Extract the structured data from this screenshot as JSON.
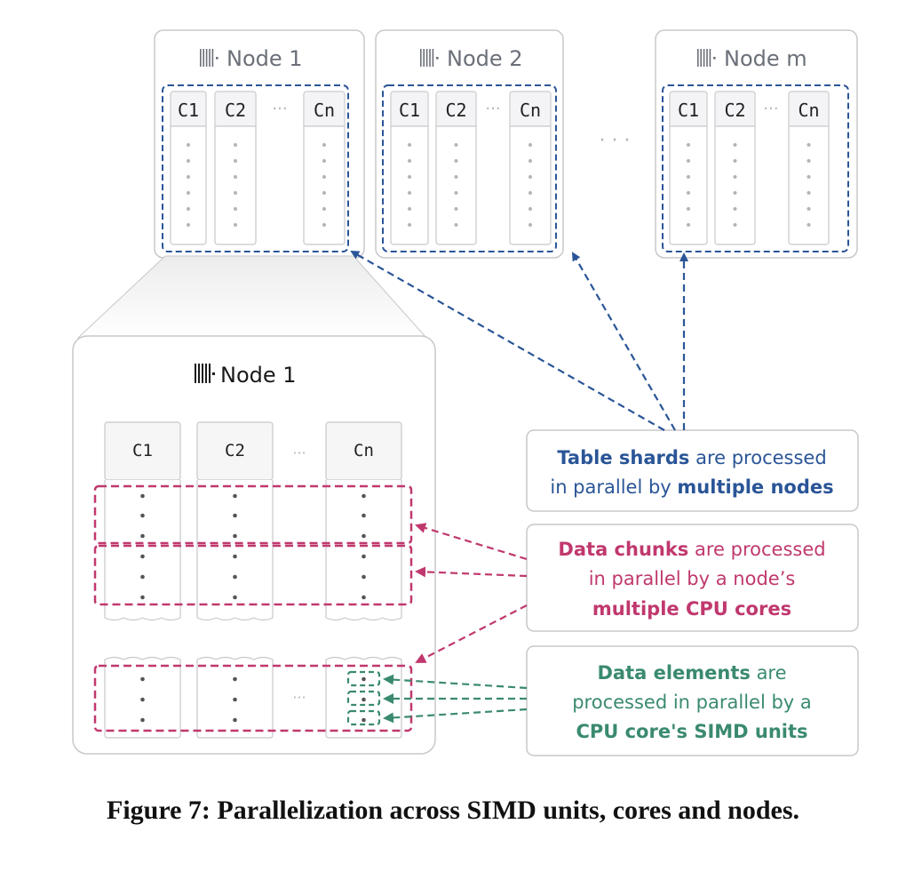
{
  "colors": {
    "blue": "#2a5597",
    "pink": "#c0386e",
    "green": "#3a8a6e",
    "box_border": "#c8c8cc",
    "dot_light": "#b4b4b8",
    "dot_dark": "#555555"
  },
  "nodes": [
    {
      "title": "Node 1",
      "columns": [
        "C1",
        "C2",
        "Cn"
      ],
      "ellipsis": "···"
    },
    {
      "title": "Node 2",
      "columns": [
        "C1",
        "C2",
        "Cn"
      ],
      "ellipsis": "···"
    },
    {
      "title": "Node m",
      "columns": [
        "C1",
        "C2",
        "Cn"
      ],
      "ellipsis": "···"
    }
  ],
  "between_nodes_ellipsis": "· · ·",
  "node_icon": "columnar-db-icon",
  "zoomed_node": {
    "title": "Node 1",
    "columns": [
      "C1",
      "C2",
      "Cn"
    ],
    "ellipsis": "···"
  },
  "callouts": {
    "shards": {
      "line1_bold": "Table shards",
      "line1_rest": " are processed",
      "line2_plain": "in parallel by ",
      "line2_bold": "multiple nodes"
    },
    "chunks": {
      "line1_bold": "Data chunks",
      "line1_rest": " are processed",
      "line2_plain": "in parallel by a node’s",
      "line3_bold": "multiple CPU cores"
    },
    "elements": {
      "line1_bold": "Data elements",
      "line1_rest": " are",
      "line2_plain": "processed in parallel by a",
      "line3_bold": "CPU core's SIMD units"
    }
  },
  "caption": "Figure 7: Parallelization across SIMD units, cores and nodes."
}
